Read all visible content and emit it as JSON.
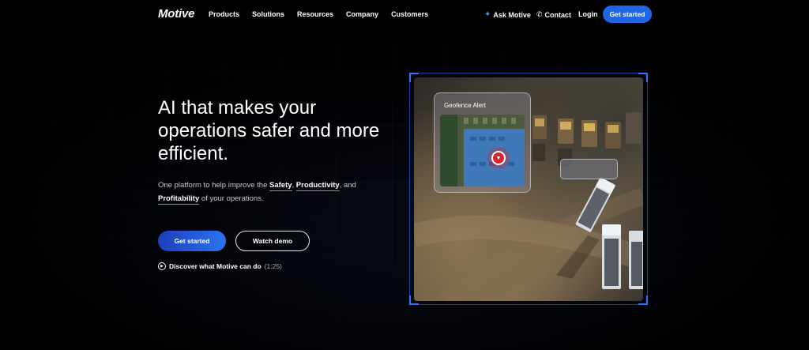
{
  "nav": {
    "logo": "Motive",
    "links": [
      "Products",
      "Solutions",
      "Resources",
      "Company",
      "Customers"
    ],
    "ask_label": "Ask Motive",
    "contact_label": "Contact",
    "login_label": "Login",
    "cta_label": "Get started"
  },
  "hero": {
    "headline": "AI that makes your operations safer and more efficient.",
    "sub_prefix": "One platform to help improve the ",
    "sub_safety": "Safety",
    "sub_sep1": ", ",
    "sub_productivity": "Productivity",
    "sub_sep2": ", and ",
    "sub_profitability": "Profitability",
    "sub_suffix": " of your operations.",
    "primary_button": "Get started",
    "secondary_button": "Watch demo",
    "discover_label": "Discover what Motive can do",
    "discover_duration": "(1:25)"
  },
  "media": {
    "geofence_title": "Geofence Alert"
  },
  "colors": {
    "accent": "#1f66e5",
    "frame_corner": "#2f74ff",
    "pin": "#d92626"
  },
  "icons": {
    "ask": "sparkle-icon",
    "contact": "phone-icon",
    "discover": "play-icon",
    "pin": "location-pin-icon"
  }
}
